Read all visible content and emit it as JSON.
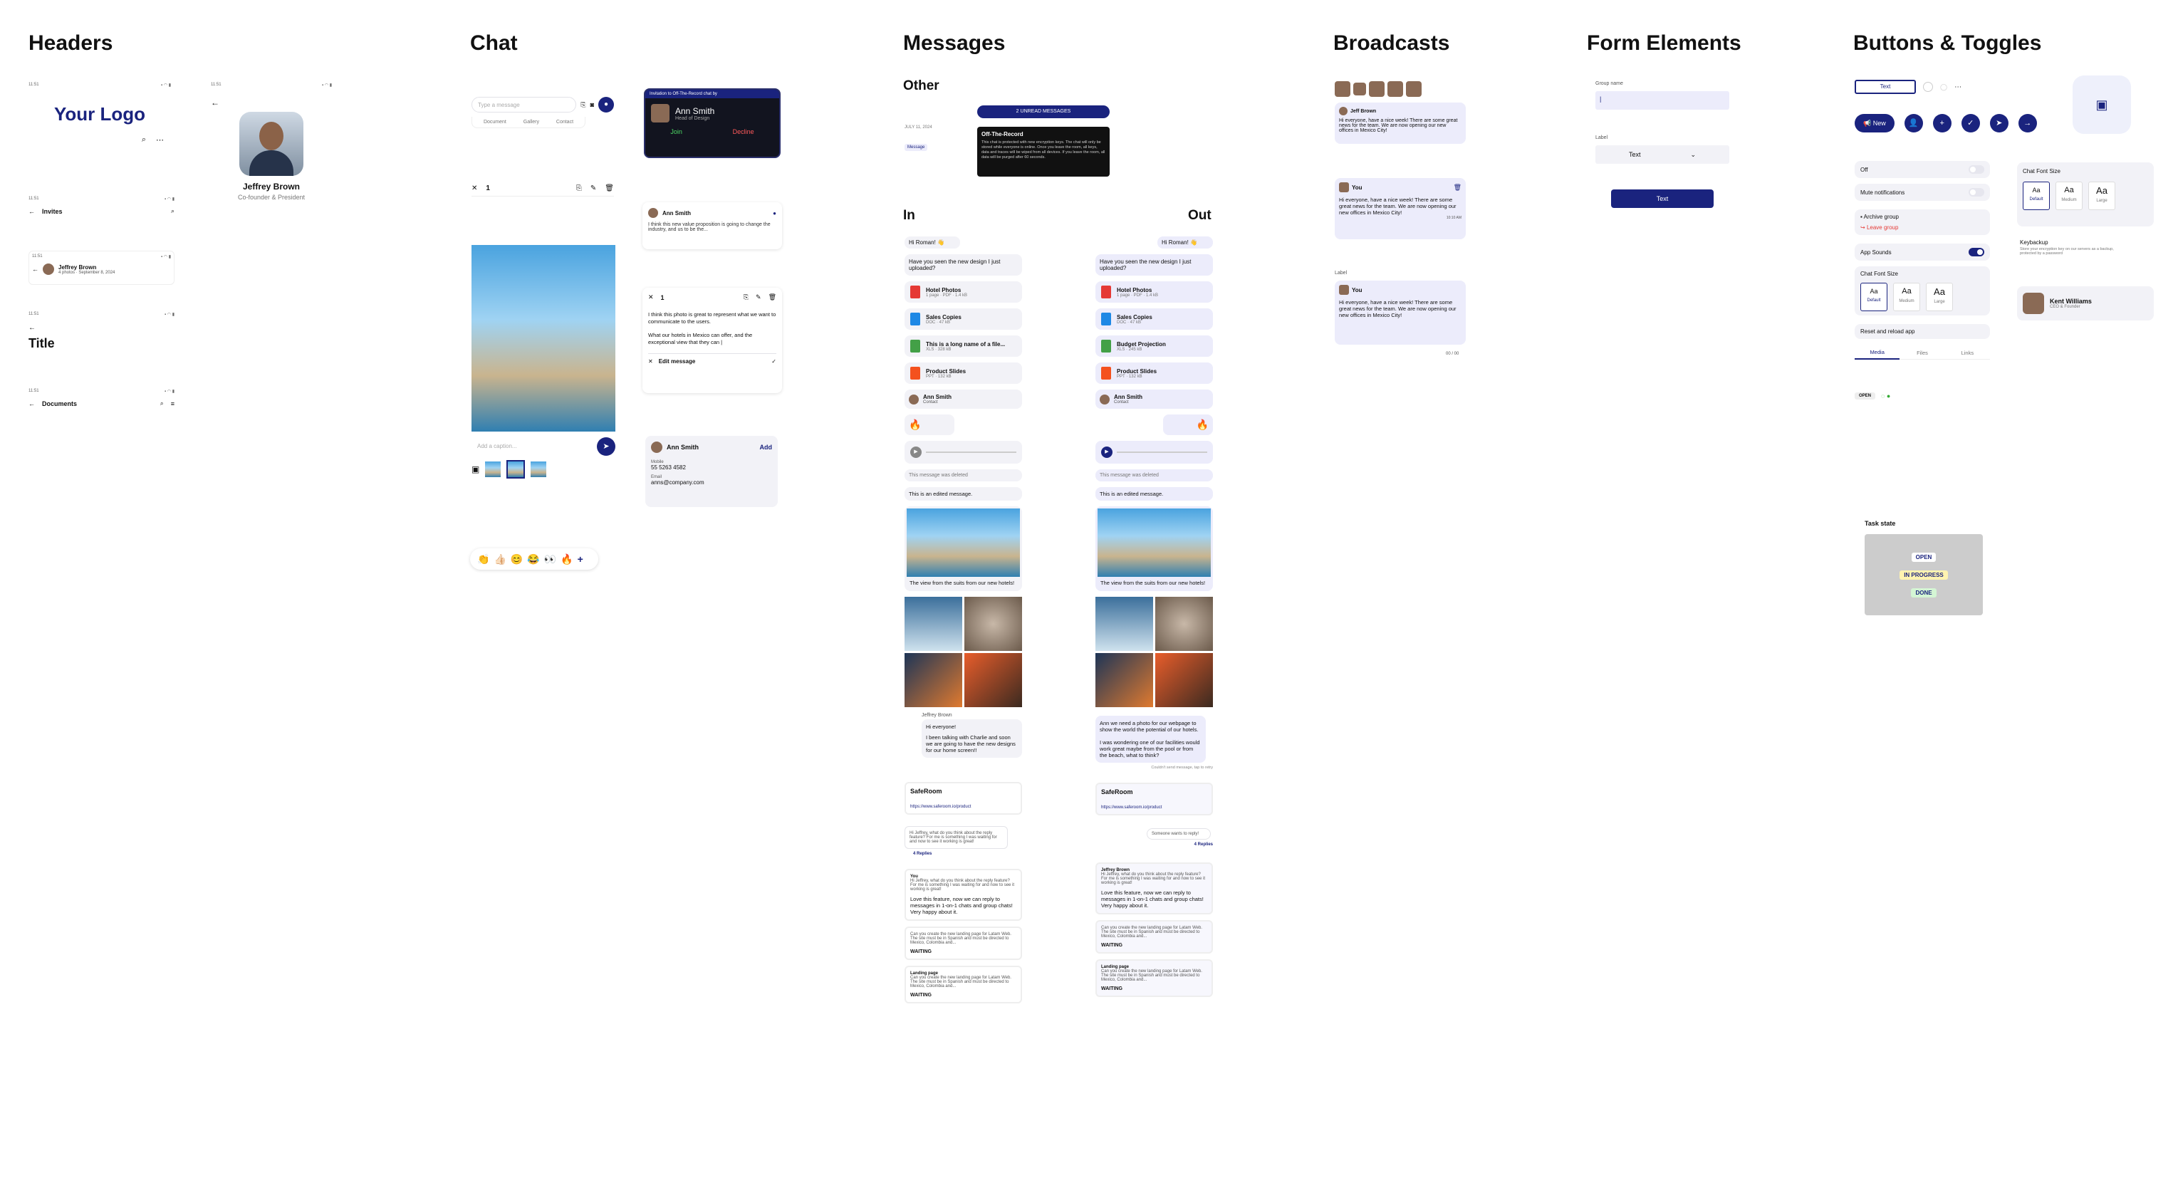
{
  "sections": {
    "headers": "Headers",
    "chat": "Chat",
    "messages": "Messages",
    "broadcasts": "Broadcasts",
    "form": "Form Elements",
    "buttons": "Buttons & Toggles"
  },
  "status_time": "11:51",
  "headers": {
    "logo": "Your Logo",
    "profile_name": "Jeffrey Brown",
    "profile_role": "Co-founder & President",
    "invites": "Invites",
    "invite_name": "Jeffrey Brown",
    "invite_sub": "4 photos · September 8, 2024",
    "title": "Title",
    "documents": "Documents"
  },
  "chat": {
    "input_placeholder": "Type a message",
    "attach": [
      "Document",
      "Gallery",
      "Contact"
    ],
    "call_banner": "Invitation to Off-The-Record chat by",
    "caller_name": "Ann Smith",
    "caller_role": "Head of Design",
    "join": "Join",
    "decline": "Decline",
    "selected_count": "1",
    "reply_name": "Ann Smith",
    "reply_text": "I think this new value proposition is going to change the industry, and us to be the...",
    "edit_text": "I think this photo is great to represent what we want to communicate to the users.\n\nWhat our hotels in Mexico can offer, and the exceptional view that they can |",
    "edit_label": "Edit message",
    "caption_placeholder": "Add a caption...",
    "contact_name": "Ann Smith",
    "contact_add": "Add",
    "mobile_label": "Mobile",
    "contact_phone": "55 5263 4582",
    "email_label": "Email",
    "contact_email": "anns@company.com",
    "reactions": [
      "👏",
      "👍🏻",
      "😊",
      "😂",
      "👀",
      "🔥",
      "+"
    ]
  },
  "messages": {
    "other": "Other",
    "date": "JULY 11, 2024",
    "message_chip": "Message",
    "unread": "2 UNREAD MESSAGES",
    "otr_title": "Off-The-Record",
    "otr_text": "This chat is protected with new encryption keys. The chat will only be stored while everyone is online. Once you leave the room, all keys, data and traces will be wiped from all devices. If you leave the room, all data will be purged after 60 seconds.",
    "in": "In",
    "out": "Out",
    "hi": "Hi Roman! 👋",
    "design_q": "Have you seen the new design I just uploaded?",
    "files_in": [
      [
        "Hotel Photos",
        "1 page · PDF · 1.4 kB"
      ],
      [
        "Sales Copies",
        "DOC · 47 kB"
      ],
      [
        "This is a long name of a file...",
        "XLS · 328 kB"
      ],
      [
        "Product Slides",
        "PPT · 132 kB"
      ]
    ],
    "files_out": [
      [
        "Hotel Photos",
        "1 page · PDF · 1.4 kB"
      ],
      [
        "Sales Copies",
        "DOC · 47 kB"
      ],
      [
        "Budget Projection",
        "XLS · 245 kB"
      ],
      [
        "Product Slides",
        "PPT · 132 kB"
      ]
    ],
    "contact": "Ann Smith",
    "contact_sub": "Contact",
    "deleted": "This message was deleted",
    "edited": "This is an edited message.",
    "photo_caption": "The view from the suits from our new hotels!",
    "sender": "Jeffrey Brown",
    "in_long1": "Hi everyone!",
    "in_long2": "I been talking with Charlie and soon we are going to have the new designs for our home screen!!",
    "out_long": "Ann we need a photo for our webpage to show the world the potential of our hotels.\n\nI was wondering one of our facilities would work great maybe from the pool or from the beach, what to think?",
    "failed": "Couldn't send message, tap to retry",
    "link_title": "SafeRoom",
    "link_url": "https://www.saferoom.io/product",
    "thread_text": "Hi Jeffrey, what do you think about the reply feature? For me is something I was waiting for and now to see it working is great!",
    "replies": "4 Replies",
    "someone": "Someone wants to reply!",
    "you": "You",
    "reply_text": "Love this feature, now we can reply to messages in 1-on-1 chats and group chats! Very happy about it.",
    "task_text": "Can you create the new landing page for Latam Web. The site must be in Spanish and must be directed to Mexico, Colombia and...",
    "waiting": "WAITING",
    "landing": "Landing page",
    "time": "10:10 PM"
  },
  "broadcasts": {
    "sender": "Jeff Brown",
    "text": "Hi everyone, have a nice week! There are some great news for the team. We are now opening our new offices in Mexico City!",
    "you": "You",
    "label": "Label",
    "counter": "00 / 00",
    "time": "10:10 AM"
  },
  "form": {
    "group_label": "Group name",
    "select_label": "Label",
    "select_value": "Text",
    "button": "Text"
  },
  "buttons": {
    "text_btn": "Text",
    "new_btn": "New",
    "off": "Off",
    "mute": "Mute notifications",
    "archive": "Archive group",
    "leave": "Leave group",
    "sounds": "App Sounds",
    "font_size": "Chat Font Size",
    "sizes": [
      [
        "Aa",
        "Default"
      ],
      [
        "Aa",
        "Medium"
      ],
      [
        "Aa",
        "Large"
      ]
    ],
    "reset": "Reset and reload app",
    "tabs": [
      "Media",
      "Files",
      "Links"
    ],
    "open": "OPEN",
    "task_state": "Task state",
    "states": [
      "OPEN",
      "IN PROGRESS",
      "DONE"
    ],
    "keybackup": "Keybackup",
    "keybackup_sub": "Store your encryption key on our servers as a backup, protected by a password",
    "user_name": "Kent Williams",
    "user_role": "CEO & Founder"
  },
  "colors": {
    "navy": "#1a237e",
    "red": "#e53935",
    "yellow": "#fff3b0",
    "green": "#d4f5d4"
  }
}
